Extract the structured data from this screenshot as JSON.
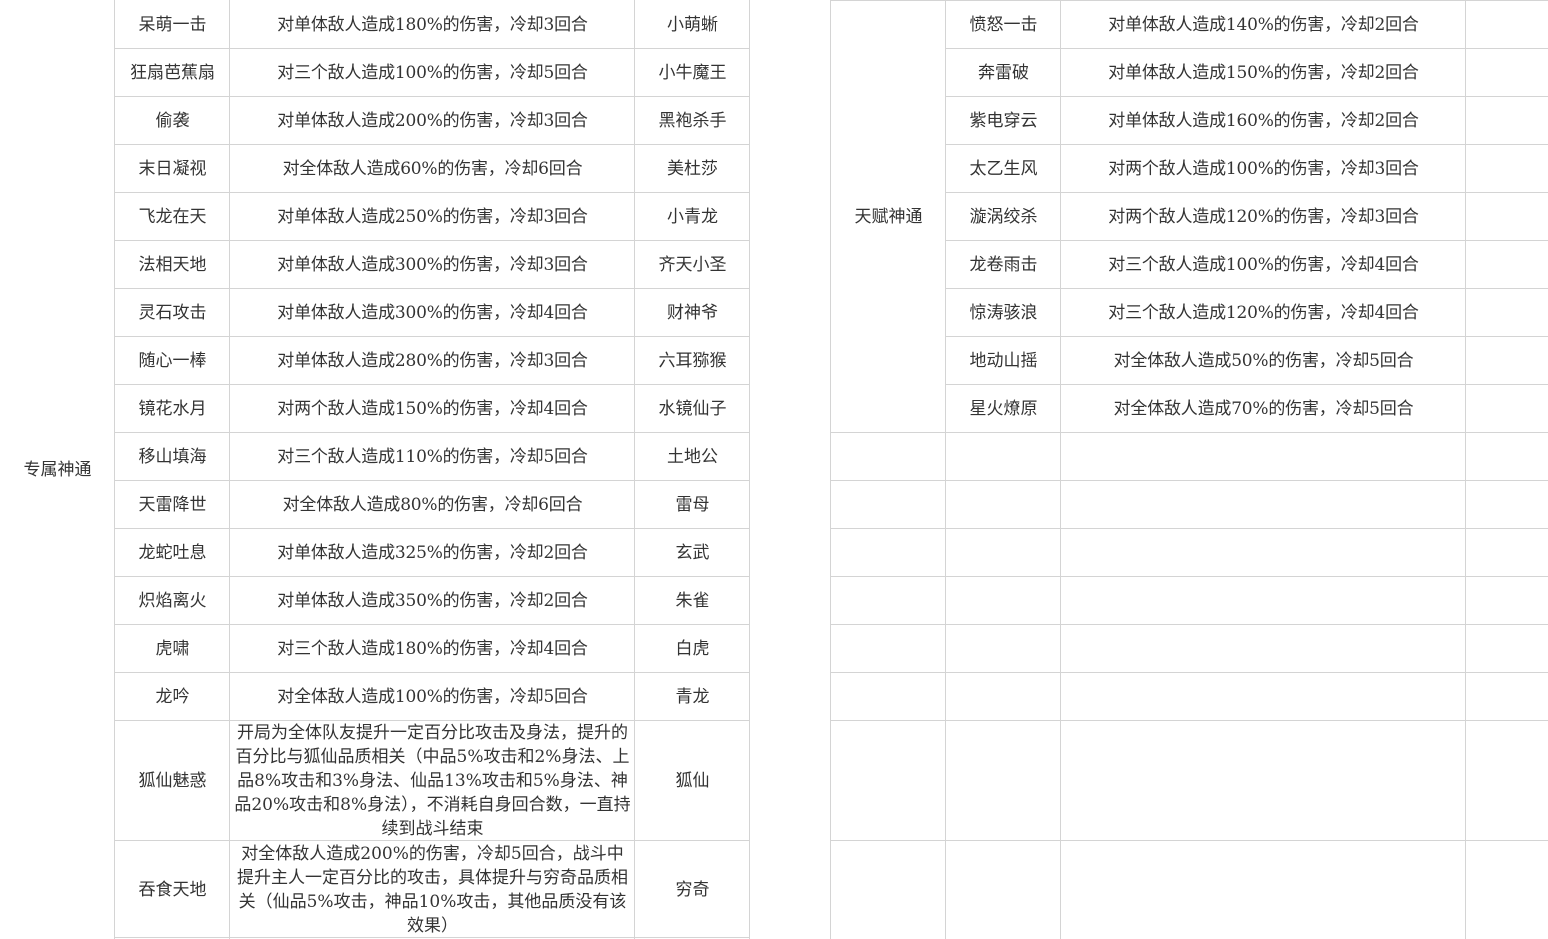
{
  "left_section": {
    "category": "专属神通",
    "rows": [
      {
        "name": "呆萌一击",
        "effect": "对单体敌人造成180%的伤害，冷却3回合",
        "owner": "小萌蜥"
      },
      {
        "name": "狂扇芭蕉扇",
        "effect": "对三个敌人造成100%的伤害，冷却5回合",
        "owner": "小牛魔王"
      },
      {
        "name": "偷袭",
        "effect": "对单体敌人造成200%的伤害，冷却3回合",
        "owner": "黑袍杀手"
      },
      {
        "name": "末日凝视",
        "effect": "对全体敌人造成60%的伤害，冷却6回合",
        "owner": "美杜莎"
      },
      {
        "name": "飞龙在天",
        "effect": "对单体敌人造成250%的伤害，冷却3回合",
        "owner": "小青龙"
      },
      {
        "name": "法相天地",
        "effect": "对单体敌人造成300%的伤害，冷却3回合",
        "owner": "齐天小圣"
      },
      {
        "name": "灵石攻击",
        "effect": "对单体敌人造成300%的伤害，冷却4回合",
        "owner": "财神爷"
      },
      {
        "name": "随心一棒",
        "effect": "对单体敌人造成280%的伤害，冷却3回合",
        "owner": "六耳猕猴"
      },
      {
        "name": "镜花水月",
        "effect": "对两个敌人造成150%的伤害，冷却4回合",
        "owner": "水镜仙子"
      },
      {
        "name": "移山填海",
        "effect": "对三个敌人造成110%的伤害，冷却5回合",
        "owner": "土地公"
      },
      {
        "name": "天雷降世",
        "effect": "对全体敌人造成80%的伤害，冷却6回合",
        "owner": "雷母"
      },
      {
        "name": "龙蛇吐息",
        "effect": "对单体敌人造成325%的伤害，冷却2回合",
        "owner": "玄武"
      },
      {
        "name": "炽焰离火",
        "effect": "对单体敌人造成350%的伤害，冷却2回合",
        "owner": "朱雀"
      },
      {
        "name": "虎啸",
        "effect": "对三个敌人造成180%的伤害，冷却4回合",
        "owner": "白虎"
      },
      {
        "name": "龙吟",
        "effect": "对全体敌人造成100%的伤害，冷却5回合",
        "owner": "青龙"
      },
      {
        "name": "狐仙魅惑",
        "effect": "开局为全体队友提升一定百分比攻击及身法，提升的百分比与狐仙品质相关（中品5%攻击和2%身法、上品8%攻击和3%身法、仙品13%攻击和5%身法、神品20%攻击和8%身法），不消耗自身回合数，一直持续到战斗结束",
        "owner": "狐仙"
      },
      {
        "name": "吞食天地",
        "effect": "对全体敌人造成200%的伤害，冷却5回合，战斗中提升主人一定百分比的攻击，具体提升与穷奇品质相关（仙品5%攻击，神品10%攻击，其他品质没有该效果）",
        "owner": "穷奇"
      }
    ]
  },
  "right_section": {
    "category": "天赋神通",
    "rows": [
      {
        "name": "愤怒一击",
        "effect": "对单体敌人造成140%的伤害，冷却2回合"
      },
      {
        "name": "奔雷破",
        "effect": "对单体敌人造成150%的伤害，冷却2回合"
      },
      {
        "name": "紫电穿云",
        "effect": "对单体敌人造成160%的伤害，冷却2回合"
      },
      {
        "name": "太乙生风",
        "effect": "对两个敌人造成100%的伤害，冷却3回合"
      },
      {
        "name": "漩涡绞杀",
        "effect": "对两个敌人造成120%的伤害，冷却3回合"
      },
      {
        "name": "龙卷雨击",
        "effect": "对三个敌人造成100%的伤害，冷却4回合"
      },
      {
        "name": "惊涛骇浪",
        "effect": "对三个敌人造成120%的伤害，冷却4回合"
      },
      {
        "name": "地动山摇",
        "effect": "对全体敌人造成50%的伤害，冷却5回合"
      },
      {
        "name": "星火燎原",
        "effect": "对全体敌人造成70%的伤害，冷却5回合"
      }
    ]
  }
}
